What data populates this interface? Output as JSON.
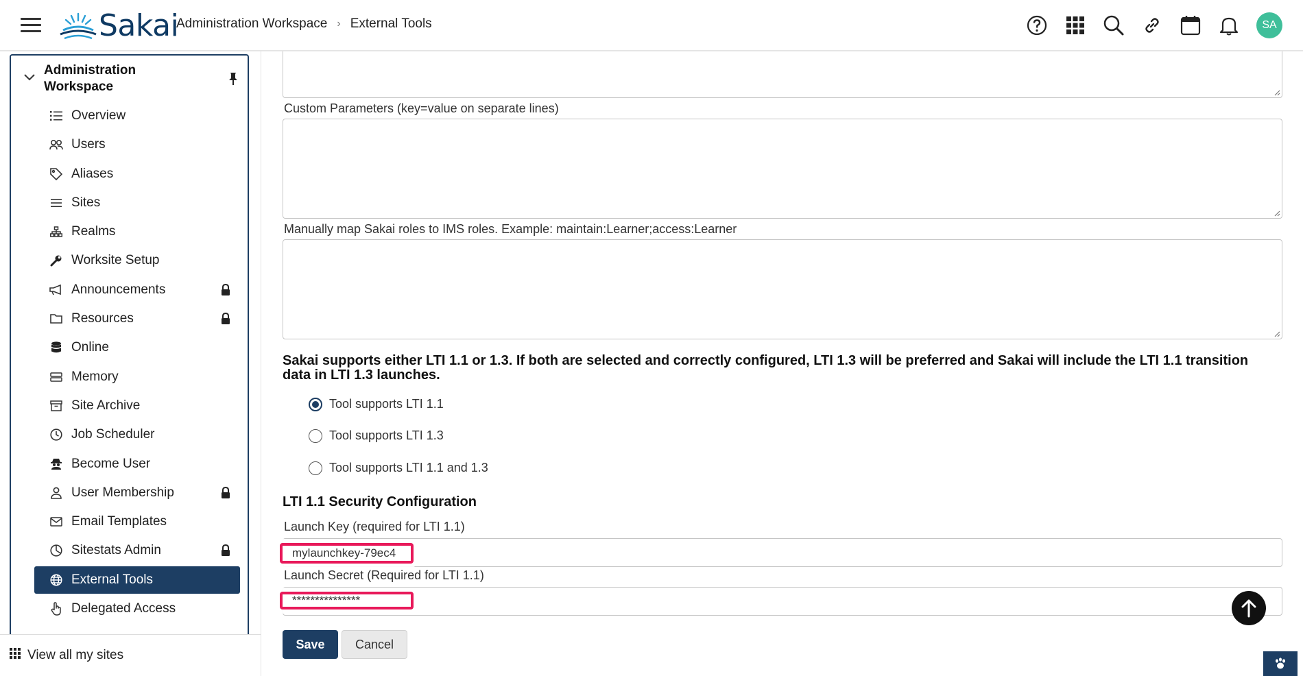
{
  "header": {
    "logo_text": "Sakai",
    "breadcrumb": [
      "Administration Workspace",
      "External Tools"
    ],
    "avatar_initials": "SA",
    "toolbar_icons": [
      "help-icon",
      "apps-grid-icon",
      "search-icon",
      "link-icon",
      "calendar-icon",
      "bell-icon"
    ]
  },
  "sidebar": {
    "title": "Administration Workspace",
    "items": [
      {
        "label": "Overview",
        "icon": "list-icon",
        "locked": false
      },
      {
        "label": "Users",
        "icon": "users-icon",
        "locked": false
      },
      {
        "label": "Aliases",
        "icon": "tag-icon",
        "locked": false
      },
      {
        "label": "Sites",
        "icon": "menu-icon",
        "locked": false
      },
      {
        "label": "Realms",
        "icon": "hierarchy-icon",
        "locked": false
      },
      {
        "label": "Worksite Setup",
        "icon": "wrench-icon",
        "locked": false
      },
      {
        "label": "Announcements",
        "icon": "megaphone-icon",
        "locked": true
      },
      {
        "label": "Resources",
        "icon": "folder-icon",
        "locked": true
      },
      {
        "label": "Online",
        "icon": "database-icon",
        "locked": false
      },
      {
        "label": "Memory",
        "icon": "memory-icon",
        "locked": false
      },
      {
        "label": "Site Archive",
        "icon": "archive-icon",
        "locked": false
      },
      {
        "label": "Job Scheduler",
        "icon": "clock-icon",
        "locked": false
      },
      {
        "label": "Become User",
        "icon": "user-secret-icon",
        "locked": false
      },
      {
        "label": "User Membership",
        "icon": "user-icon",
        "locked": true
      },
      {
        "label": "Email Templates",
        "icon": "envelope-icon",
        "locked": false
      },
      {
        "label": "Sitestats Admin",
        "icon": "pie-chart-icon",
        "locked": true
      },
      {
        "label": "External Tools",
        "icon": "globe-icon",
        "locked": false,
        "active": true
      },
      {
        "label": "Delegated Access",
        "icon": "hand-pointer-icon",
        "locked": false
      }
    ],
    "footer_label": "View all my sites"
  },
  "main": {
    "custom_params_label": "Custom Parameters (key=value on separate lines)",
    "role_map_label": "Manually map Sakai roles to IMS roles. Example: maintain:Learner;access:Learner",
    "notice": "Sakai supports either LTI 1.1 or 1.3. If both are selected and correctly configured, LTI 1.3 will be preferred and Sakai will include the LTI 1.1 transition data in LTI 1.3 launches.",
    "radios": [
      {
        "label": "Tool supports LTI 1.1",
        "checked": true
      },
      {
        "label": "Tool supports LTI 1.3",
        "checked": false
      },
      {
        "label": "Tool supports LTI 1.1 and 1.3",
        "checked": false
      }
    ],
    "security_title": "LTI 1.1 Security Configuration",
    "launch_key_label": "Launch Key (required for LTI 1.1)",
    "launch_key_value": "mylaunchkey-79ec4",
    "launch_secret_label": "Launch Secret (Required for LTI 1.1)",
    "launch_secret_value": "***************",
    "save_label": "Save",
    "cancel_label": "Cancel"
  },
  "colors": {
    "brand": "#1d3e63",
    "highlight": "#e8195a",
    "avatar": "#3fbf9a"
  }
}
